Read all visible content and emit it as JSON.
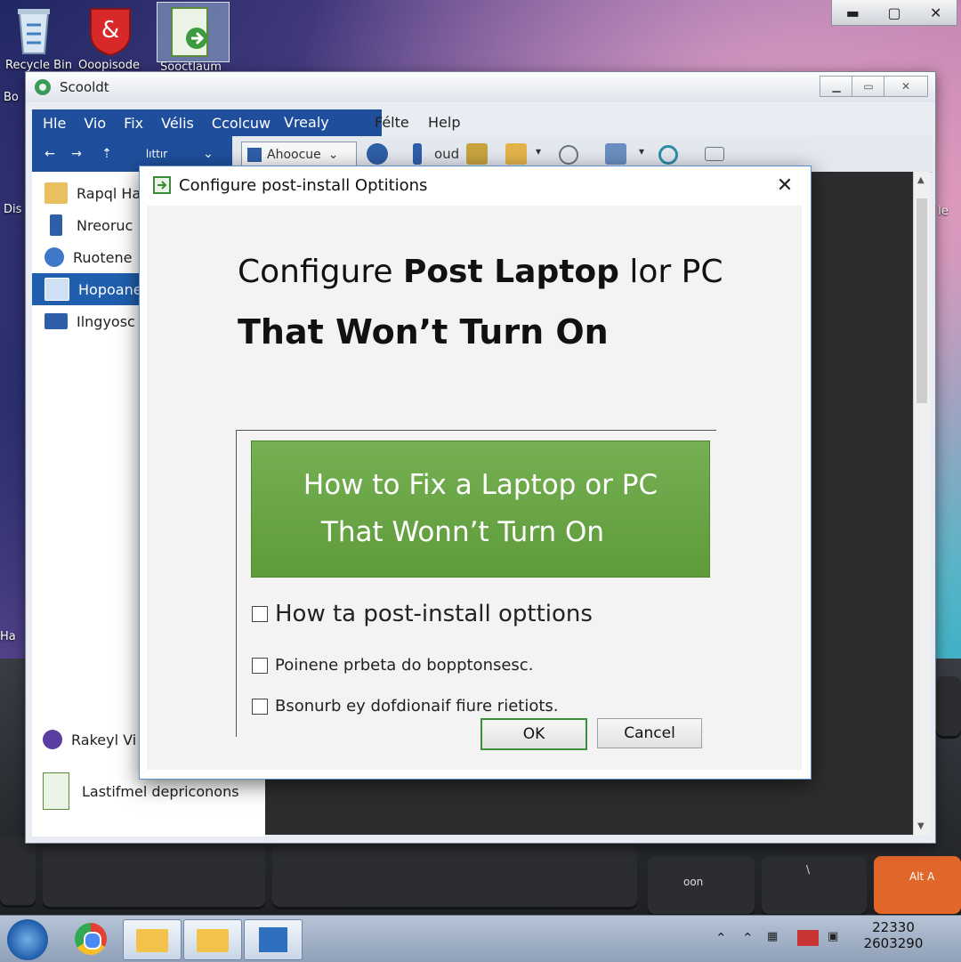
{
  "desktop": {
    "icons": [
      {
        "name": "recycle-bin-icon",
        "label": "Recycle Bin"
      },
      {
        "name": "app-red-icon",
        "label": "Ooopisode"
      },
      {
        "name": "app-green-icon",
        "label": "Sooctlaum"
      }
    ],
    "side_labels": [
      "Bo",
      "Dis",
      "Ie",
      "Ha"
    ]
  },
  "top_controls": {
    "minimize": "▬",
    "maximize": "▢",
    "close": "✕"
  },
  "explorer": {
    "title": "Scooldt",
    "menu": [
      "Hle",
      "Vio",
      "Fix",
      "Vélis",
      "Ccolcuw",
      "Vrealy",
      "Félte",
      "Help"
    ],
    "toolbar": {
      "back": "←",
      "forward": "→",
      "up": "⇡",
      "path": "lıttır",
      "dropdown": "⌄",
      "address": "Ahoocue",
      "view_label": "oud"
    },
    "nav_items": [
      {
        "label": "Rapql Ha",
        "selected": false
      },
      {
        "label": "Nreoruc",
        "selected": false
      },
      {
        "label": "Ruotene",
        "selected": false
      },
      {
        "label": "Hopoane",
        "selected": true
      },
      {
        "label": "Ilngyosc",
        "selected": false
      }
    ],
    "nav_bottom": [
      {
        "label": "Rakeyl Vi"
      },
      {
        "label": "Lastifmel depriconons"
      }
    ]
  },
  "dialog": {
    "title": "Configure post-install Optitions",
    "close": "✕",
    "heading_line1_regular": "Configure ",
    "heading_line1_bold": "Post Laptop",
    "heading_line1_tail": " lor PC",
    "heading_line2": "That Won’t Turn On",
    "banner_line1": "How to Fix a Laptop or PC",
    "banner_line2": "That Wonn’t Turn On",
    "options": [
      {
        "label": "How ta post-install opttions",
        "checked": false
      },
      {
        "label": "Poinene prbeta do bopptonsesc.",
        "checked": false
      },
      {
        "label": "Bsonurb ey dofdionaif fiure rietiots.",
        "checked": false
      }
    ],
    "ok_label": "OK",
    "cancel_label": "Cancel"
  },
  "taskbar": {
    "clock_time": "22330",
    "clock_date": "2603290"
  },
  "keyboard": {
    "key1": "oon",
    "key2": "\\",
    "key3": "Alt\nA"
  },
  "colors": {
    "menu_blue": "#1f4f9c",
    "banner_green": "#6aa547",
    "selected_blue": "#1f5fae"
  }
}
